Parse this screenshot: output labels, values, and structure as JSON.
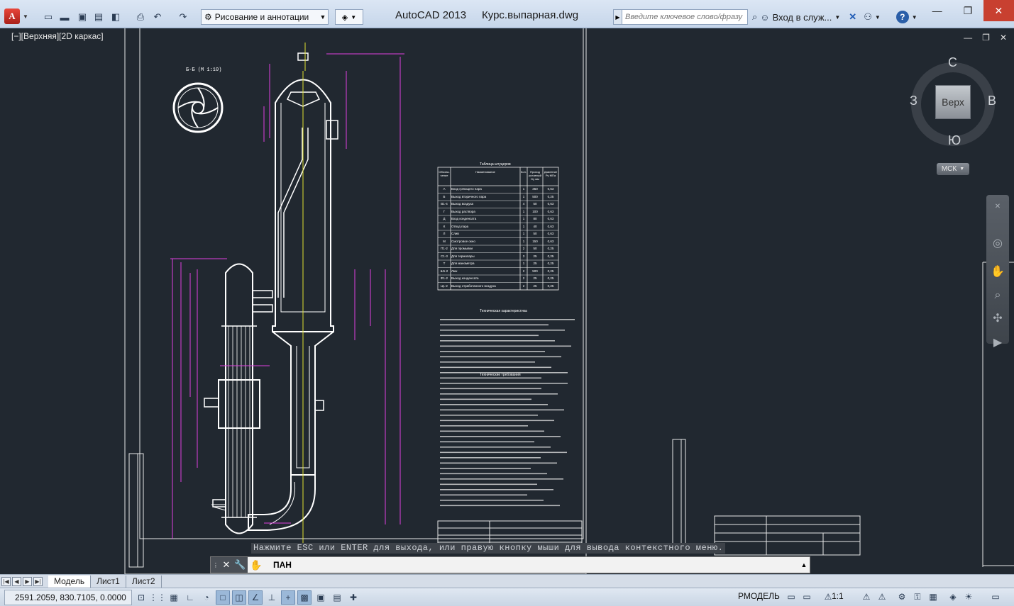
{
  "titlebar": {
    "app_title": "AutoCAD 2013",
    "file_title": "Курс.выпарная.dwg",
    "workspace": "Рисование и аннотации",
    "search_placeholder": "Введите ключевое слово/фразу",
    "signin_label": "Вход в служ..."
  },
  "viewport": {
    "label": "[−][Верхняя][2D каркас]",
    "viewcube": {
      "face": "Верх",
      "north": "С",
      "south": "Ю",
      "east": "В",
      "west": "З",
      "ucs": "МСК"
    }
  },
  "drawing": {
    "section_label": "Б-Б (М 1:10)",
    "nozzle_table": {
      "title": "Таблица штуцеров",
      "headers": [
        "Обозна-чение",
        "Наименование",
        "Кол.",
        "Проход условный Dу мм",
        "Давление Ру МПа"
      ],
      "rows": [
        [
          "А",
          "Вход греющего пара",
          "1",
          "350",
          "0,63"
        ],
        [
          "Б",
          "Выход вторичного пара",
          "1",
          "500",
          "0,25"
        ],
        [
          "В1-4",
          "Выход воздуха",
          "4",
          "50",
          "0,63"
        ],
        [
          "Г",
          "Выход раствора",
          "1",
          "100",
          "0,63"
        ],
        [
          "Д",
          "Вход конденсата",
          "1",
          "80",
          "0,63"
        ],
        [
          "К",
          "Отвод пара",
          "1",
          "40",
          "0,63"
        ],
        [
          "Л",
          "Слив",
          "1",
          "50",
          "0,63"
        ],
        [
          "М",
          "Смотровое окно",
          "1",
          "150",
          "0,63"
        ],
        [
          "П1-2",
          "Для промывки",
          "2",
          "50",
          "0,25"
        ],
        [
          "С1-3",
          "Для термопары",
          "3",
          "25",
          "0,25"
        ],
        [
          "Т",
          "Для манометра",
          "1",
          "25",
          "0,25"
        ],
        [
          "Ш1-2",
          "Люк",
          "2",
          "500",
          "0,25"
        ],
        [
          "Ф1-2",
          "Выход конденсата",
          "2",
          "25",
          "0,25"
        ],
        [
          "Ц1-2",
          "Выход отработанного воздуха",
          "2",
          "25",
          "0,25"
        ]
      ]
    },
    "tech_title_1": "Техническая характеристика",
    "tech_title_2": "Технические требования"
  },
  "tooltip": "Нажмите ESC или ENTER для выхода, или правую кнопку мыши для вывода контекстного меню.",
  "command": {
    "prompt": "ПАН"
  },
  "layout_tabs": [
    "Модель",
    "Лист1",
    "Лист2"
  ],
  "status": {
    "coords": "2591.2059, 830.7105, 0.0000",
    "model": "РМОДЕЛЬ",
    "scale": "1:1"
  }
}
